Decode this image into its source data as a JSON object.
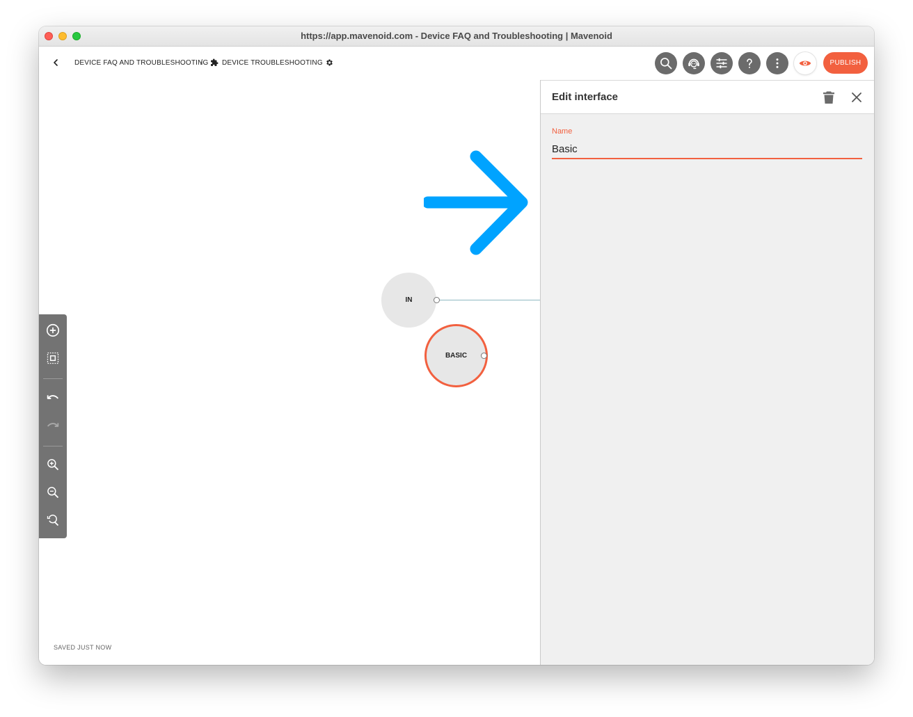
{
  "window": {
    "url_title": "https://app.mavenoid.com - Device FAQ and Troubleshooting | Mavenoid"
  },
  "topbar": {
    "breadcrumb_root": "DEVICE FAQ AND TROUBLESHOOTING",
    "breadcrumb_separator": "/",
    "breadcrumb_current": "DEVICE TROUBLESHOOTING",
    "publish_label": "PUBLISH",
    "icons": [
      "back-chevron-icon",
      "puzzle-icon",
      "gear-icon",
      "search-icon",
      "support-agent-icon",
      "sliders-icon",
      "help-icon",
      "more-vertical-icon",
      "preview-eye-icon"
    ],
    "accent_color": "#f2603f"
  },
  "canvas": {
    "nodes": [
      {
        "label": "IN"
      },
      {
        "label": "BASIC"
      }
    ],
    "status": "SAVED JUST NOW",
    "toolbar_icons": [
      "add-node-icon",
      "select-area-icon",
      "undo-icon",
      "redo-icon",
      "zoom-in-icon",
      "zoom-out-icon",
      "zoom-reset-icon"
    ],
    "annotation_arrow_color": "#00a3ff"
  },
  "panel": {
    "title": "Edit interface",
    "name_label": "Name",
    "name_value": "Basic",
    "icons": [
      "trash-icon",
      "close-icon"
    ]
  }
}
